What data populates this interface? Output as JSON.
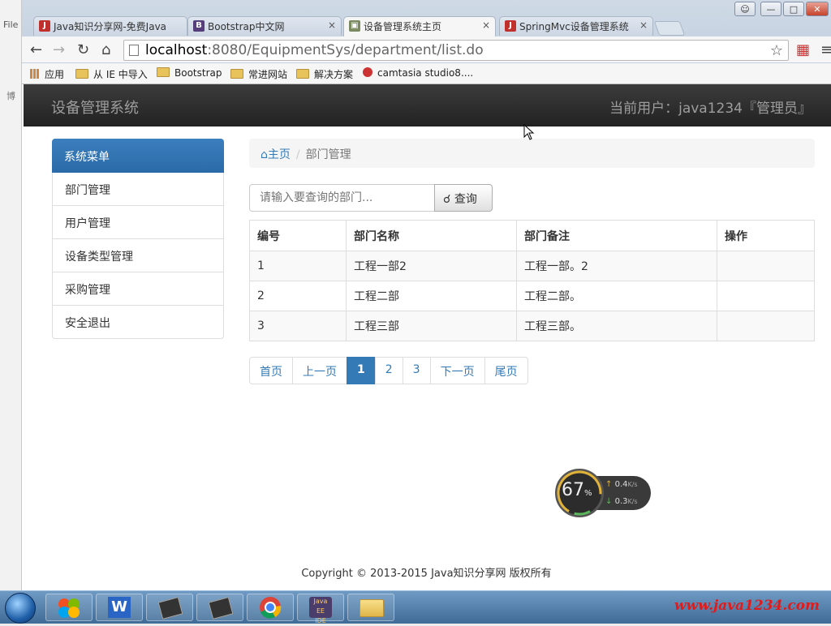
{
  "bg_window": {
    "label": "File",
    "side_char": "博"
  },
  "browser": {
    "tabs": [
      {
        "label": "Java知识分享网-免费Java",
        "favicon": "J",
        "color": "#c0302c"
      },
      {
        "label": "Bootstrap中文网",
        "favicon": "B",
        "color": "#563d7c"
      },
      {
        "label": "设备管理系统主页",
        "favicon": "▣",
        "color": "#7a8a60"
      },
      {
        "label": "SpringMvc设备管理系统",
        "favicon": "J",
        "color": "#c0302c"
      }
    ],
    "close_glyph": "×",
    "url_host": "localhost",
    "url_rest": ":8080/EquipmentSys/department/list.do",
    "bookmarks": [
      "应用",
      "从 IE 中导入",
      "Bootstrap",
      "常进网站",
      "解决方案",
      "camtasia studio8...."
    ],
    "window_buttons": [
      "—",
      "□",
      "✕"
    ]
  },
  "app": {
    "brand": "设备管理系统",
    "current_user": "当前用户：java1234『管理员』"
  },
  "sidebar": {
    "header": "系统菜单",
    "items": [
      {
        "label": "部门管理"
      },
      {
        "label": "用户管理"
      },
      {
        "label": "设备类型管理"
      },
      {
        "label": "采购管理"
      },
      {
        "label": "安全退出"
      }
    ]
  },
  "breadcrumb": {
    "home": "主页",
    "separator": "/",
    "current": "部门管理"
  },
  "search": {
    "placeholder": "请输入要查询的部门...",
    "button": "查询"
  },
  "table": {
    "headers": [
      "编号",
      "部门名称",
      "部门备注",
      "操作"
    ],
    "rows": [
      [
        "1",
        "工程一部2",
        "工程一部。2",
        ""
      ],
      [
        "2",
        "工程二部",
        "工程二部。",
        ""
      ],
      [
        "3",
        "工程三部",
        "工程三部。",
        ""
      ]
    ]
  },
  "pagination": {
    "first": "首页",
    "prev": "上一页",
    "pages": [
      "1",
      "2",
      "3"
    ],
    "active": "1",
    "next": "下一页",
    "last": "尾页"
  },
  "footer": "Copyright © 2013-2015 Java知识分享网 版权所有",
  "speed_widget": {
    "percent": "67",
    "percent_sign": "%",
    "up": "0.4",
    "down": "0.3",
    "unit": "K/s"
  },
  "taskbar": {
    "watermark": "www.java1234.com"
  },
  "colors": {
    "primary": "#337ab7",
    "navbar": "#222222",
    "sidebar_active": "#2a6aa8"
  }
}
